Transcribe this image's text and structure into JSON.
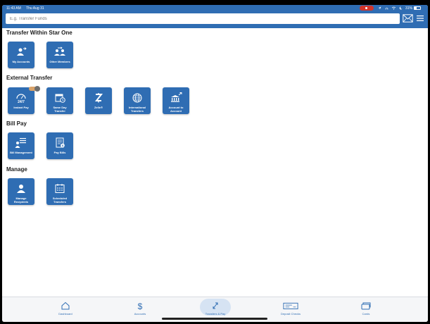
{
  "status_bar": {
    "time": "11:43 AM",
    "date": "Thu Aug 31",
    "battery": "31%",
    "recording_color": "#d2342a"
  },
  "header": {
    "search_placeholder": "E.g. Transfer Funds",
    "mail_icon": "mail-icon",
    "menu_icon": "hamburger-menu-icon"
  },
  "colors": {
    "brand": "#2f6db3",
    "active_tab_bg": "#d6e3f3"
  },
  "sections": [
    {
      "title": "Transfer Within Star One",
      "tiles": [
        {
          "label": "My Accounts",
          "icon": "accounts-transfer-icon"
        },
        {
          "label": "Other Members",
          "icon": "members-transfer-icon"
        }
      ]
    },
    {
      "title": "External Transfer",
      "tiles": [
        {
          "label": "Instant Pay",
          "icon": "instant-pay-24-7-icon"
        },
        {
          "label": "Same Day Transfer",
          "icon": "calendar-clock-icon"
        },
        {
          "label": "Zelle®",
          "icon": "zelle-icon"
        },
        {
          "label": "International Transfers",
          "icon": "globe-icon"
        },
        {
          "label": "Account to Account",
          "icon": "bank-transfer-icon"
        }
      ]
    },
    {
      "title": "Bill Pay",
      "tiles": [
        {
          "label": "Bill Management",
          "icon": "bill-management-icon"
        },
        {
          "label": "Pay Bills",
          "icon": "pay-bills-icon"
        }
      ]
    },
    {
      "title": "Manage",
      "tiles": [
        {
          "label": "Manage Recipients",
          "icon": "recipients-icon"
        },
        {
          "label": "Scheduled Transfers",
          "icon": "scheduled-calendar-icon"
        }
      ]
    }
  ],
  "tabbar": {
    "tabs": [
      {
        "label": "Dashboard",
        "icon": "home-icon"
      },
      {
        "label": "Accounts",
        "icon": "dollar-icon"
      },
      {
        "label": "Transfers & Pay",
        "icon": "transfer-arrows-icon",
        "active": true
      },
      {
        "label": "Deposit Checks",
        "icon": "check-icon"
      },
      {
        "label": "Cards",
        "icon": "card-icon"
      }
    ]
  }
}
